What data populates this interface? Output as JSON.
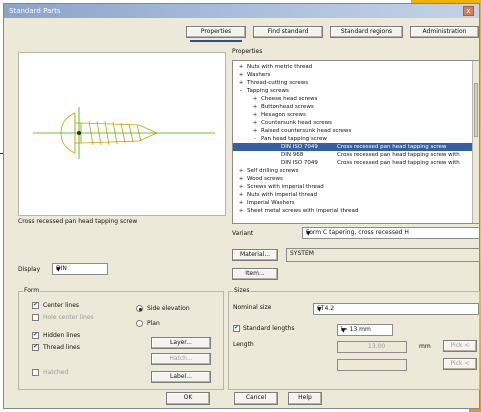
{
  "window": {
    "title": "Standard Parts",
    "close_glyph": "x"
  },
  "tabs": [
    "Properties",
    "Find standard",
    "Standard regions",
    "Administration"
  ],
  "properties_label": "Properties",
  "tree": [
    {
      "toggle": "+",
      "label": "Nuts with metric thread",
      "desc": ""
    },
    {
      "toggle": "+",
      "label": "Washers",
      "desc": ""
    },
    {
      "toggle": "+",
      "label": "Thread-cutting screws",
      "desc": ""
    },
    {
      "toggle": "-",
      "label": "Tapping screws",
      "desc": ""
    },
    {
      "toggle": "+",
      "label": "Cheese head screws",
      "desc": ""
    },
    {
      "toggle": "+",
      "label": "Buttonhead screws",
      "desc": ""
    },
    {
      "toggle": "+",
      "label": "Hexagon screws",
      "desc": ""
    },
    {
      "toggle": "+",
      "label": "Countersunk head screws",
      "desc": ""
    },
    {
      "toggle": "+",
      "label": "Raised countersunk head screws",
      "desc": ""
    },
    {
      "toggle": "-",
      "label": "Pan head tapping screw",
      "desc": ""
    },
    {
      "toggle": "",
      "label": "DIN ISO 7049",
      "desc": "Cross recessed pan head tapping screw",
      "selected": true
    },
    {
      "toggle": "",
      "label": "DIN 968",
      "desc": "Cross recessed pan head tapping screw with"
    },
    {
      "toggle": "",
      "label": "DIN ISO 7049",
      "desc": "Cross recessed pan head tapping screw with"
    },
    {
      "toggle": "+",
      "label": "Self drilling screws",
      "desc": ""
    },
    {
      "toggle": "+",
      "label": "Wood screws",
      "desc": ""
    },
    {
      "toggle": "+",
      "label": "Screws with imperial thread",
      "desc": ""
    },
    {
      "toggle": "+",
      "label": "Nuts with imperial thread",
      "desc": ""
    },
    {
      "toggle": "+",
      "label": "Imperial Washers",
      "desc": ""
    },
    {
      "toggle": "+",
      "label": "Sheet metal screws with imperial thread",
      "desc": ""
    }
  ],
  "part_description": "Cross recessed pan head tapping screw",
  "display": {
    "label": "Display",
    "value": "DIN"
  },
  "variant": {
    "label": "Variant",
    "value": "Form C tapering, cross recessed H"
  },
  "material": {
    "button": "Material...",
    "value": "SYSTEM"
  },
  "item_button": "Item...",
  "form": {
    "label": "Form",
    "center_lines": "Center lines",
    "hole_center_lines": "Hole center lines",
    "hidden_lines": "Hidden lines",
    "thread_lines": "Thread lines",
    "hatched": "Hatched",
    "side_elevation": "Side elevation",
    "plan": "Plan",
    "layer_button": "Layer...",
    "hatch_button": "Hatch...",
    "label_button": "Label..."
  },
  "sizes": {
    "label": "Sizes",
    "nominal_label": "Nominal size",
    "nominal_value": "ST4.2",
    "standard_lengths": "Standard lengths",
    "length_select": "l= 13 mm",
    "length_label": "Length",
    "length_value": "13.00",
    "unit": "mm",
    "pick1": "Pick <",
    "pick2": "Pick <"
  },
  "footer": {
    "ok": "OK",
    "cancel": "Cancel",
    "help": "Help"
  }
}
